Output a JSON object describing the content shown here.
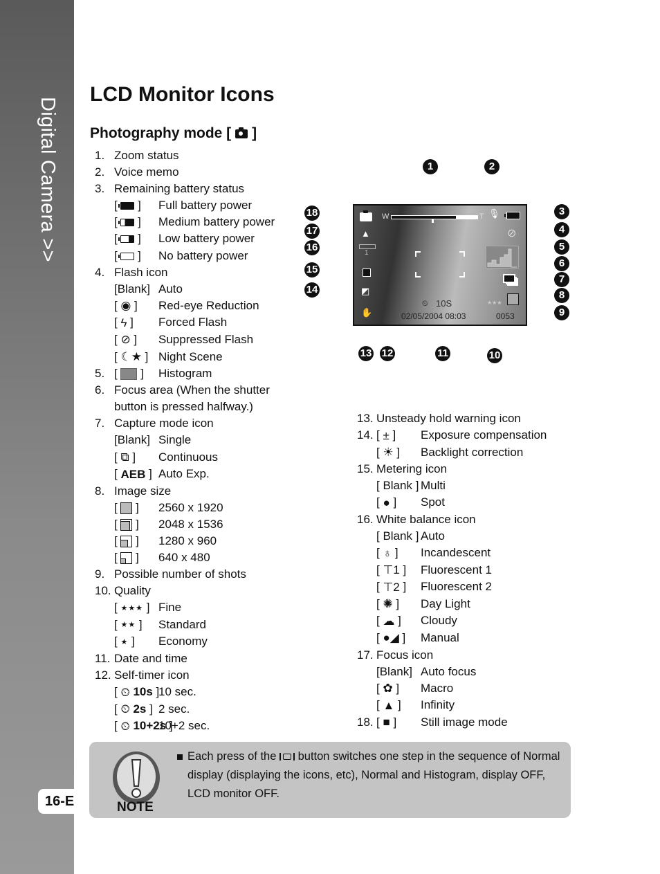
{
  "sidebar": {
    "title": "Digital Camera >>",
    "page_number": "16-E"
  },
  "title": "LCD Monitor Icons",
  "subtitle": {
    "text": "Photography mode [",
    "icon": "camera-icon",
    "close": "]"
  },
  "left_list": [
    {
      "num": "1.",
      "label": "Zoom status"
    },
    {
      "num": "2.",
      "label": "Voice memo"
    },
    {
      "num": "3.",
      "label": "Remaining battery status",
      "subs": [
        {
          "icon": "battery-full-icon",
          "label": "Full battery power"
        },
        {
          "icon": "battery-medium-icon",
          "label": "Medium battery power"
        },
        {
          "icon": "battery-low-icon",
          "label": "Low battery power"
        },
        {
          "icon": "battery-empty-icon",
          "label": "No battery power"
        }
      ]
    },
    {
      "num": "4.",
      "label": "Flash icon",
      "subs": [
        {
          "bracket": "[Blank]",
          "label": "Auto"
        },
        {
          "glyph": "◉",
          "icon": "red-eye-icon",
          "label": "Red-eye Reduction"
        },
        {
          "glyph": "ϟ",
          "icon": "flash-icon",
          "label": "Forced Flash"
        },
        {
          "glyph": "⊘",
          "icon": "flash-off-icon",
          "label": "Suppressed Flash"
        },
        {
          "glyph": "☾★",
          "icon": "night-scene-icon",
          "label": "Night Scene"
        }
      ]
    },
    {
      "num": "5.",
      "icon": "histogram-icon",
      "label": "Histogram"
    },
    {
      "num": "6.",
      "label": "Focus area (When the shutter",
      "label2": "button is pressed halfway.)"
    },
    {
      "num": "7.",
      "label": "Capture mode icon",
      "subs": [
        {
          "bracket": "[Blank]",
          "label": "Single"
        },
        {
          "glyph": "⧉",
          "icon": "continuous-icon",
          "label": "Continuous"
        },
        {
          "glyph": "AEB",
          "icon": "aeb-icon",
          "label": "Auto Exp."
        }
      ]
    },
    {
      "num": "8.",
      "label": "Image size",
      "subs": [
        {
          "icon": "size-2560-icon",
          "fill": 1.0,
          "label": "2560 x 1920"
        },
        {
          "icon": "size-2048-icon",
          "fill": 0.8,
          "label": "2048 x 1536"
        },
        {
          "icon": "size-1280-icon",
          "fill": 0.6,
          "label": "1280 x 960"
        },
        {
          "icon": "size-640-icon",
          "fill": 0.4,
          "label": "640 x 480"
        }
      ]
    },
    {
      "num": "9.",
      "label": "Possible number of shots"
    },
    {
      "num": "10.",
      "label": "Quality",
      "subs": [
        {
          "glyph": "★★★",
          "icon": "quality-fine-icon",
          "label": "Fine"
        },
        {
          "glyph": "★★",
          "icon": "quality-standard-icon",
          "label": "Standard"
        },
        {
          "glyph": "★",
          "icon": "quality-economy-icon",
          "label": "Economy"
        }
      ]
    },
    {
      "num": "11.",
      "label": "Date and time"
    },
    {
      "num": "12.",
      "label": "Self-timer icon",
      "subs": [
        {
          "glyph": "⏲",
          "bold": "10s",
          "label": "10 sec."
        },
        {
          "glyph": "⏲",
          "bold": "2s",
          "label": "2 sec."
        },
        {
          "glyph": "⏲",
          "bold": "10+2s",
          "label": "10+2 sec."
        }
      ]
    }
  ],
  "right_list": [
    {
      "num": "13.",
      "label": "Unsteady hold warning icon"
    },
    {
      "num": "14.",
      "glyph": "±",
      "icon": "exposure-compensation-icon",
      "label": "Exposure compensation"
    },
    {
      "glyph": "☀",
      "icon": "backlight-icon",
      "label": "Backlight correction"
    },
    {
      "num": "15.",
      "label": "Metering icon"
    },
    {
      "bracket": "[ Blank ]",
      "label": "Multi"
    },
    {
      "glyph": "●",
      "icon": "spot-metering-icon",
      "label": "Spot"
    },
    {
      "num": "16.",
      "label": "White balance icon"
    },
    {
      "bracket": "[ Blank ]",
      "label": "Auto"
    },
    {
      "glyph": "♁",
      "icon": "incandescent-icon",
      "label": "Incandescent"
    },
    {
      "glyph": "⊤1",
      "icon": "fluorescent1-icon",
      "label": "Fluorescent 1"
    },
    {
      "glyph": "⊤2",
      "icon": "fluorescent2-icon",
      "label": "Fluorescent 2"
    },
    {
      "glyph": "✺",
      "icon": "daylight-icon",
      "label": "Day Light"
    },
    {
      "glyph": "☁",
      "icon": "cloudy-icon",
      "label": "Cloudy"
    },
    {
      "glyph": "●◢",
      "icon": "manual-wb-icon",
      "label": "Manual"
    },
    {
      "num": "17.",
      "label": "Focus icon"
    },
    {
      "bracket": "[Blank]",
      "label": "Auto focus"
    },
    {
      "glyph": "✿",
      "icon": "macro-icon",
      "label": "Macro"
    },
    {
      "glyph": "▲",
      "icon": "infinity-icon",
      "label": "Infinity"
    },
    {
      "num": "18.",
      "glyph": "■",
      "icon": "camera-icon",
      "label": "Still image mode"
    }
  ],
  "lcd": {
    "zoom_w": "W",
    "zoom_t": "T",
    "wb_count": "1",
    "timer": "10S",
    "datetime": "02/05/2004 08:03",
    "shots": "0053",
    "quality": "★★★",
    "callouts": [
      "1",
      "2",
      "3",
      "4",
      "5",
      "6",
      "7",
      "8",
      "9",
      "10",
      "11",
      "12",
      "13",
      "14",
      "15",
      "16",
      "17",
      "18"
    ]
  },
  "note": {
    "label": "NOTE",
    "text_before": "Each press of the",
    "text_after": "button switches one step in the sequence of Normal display (displaying the icons, etc), Normal and Histogram, display OFF, LCD monitor OFF."
  }
}
